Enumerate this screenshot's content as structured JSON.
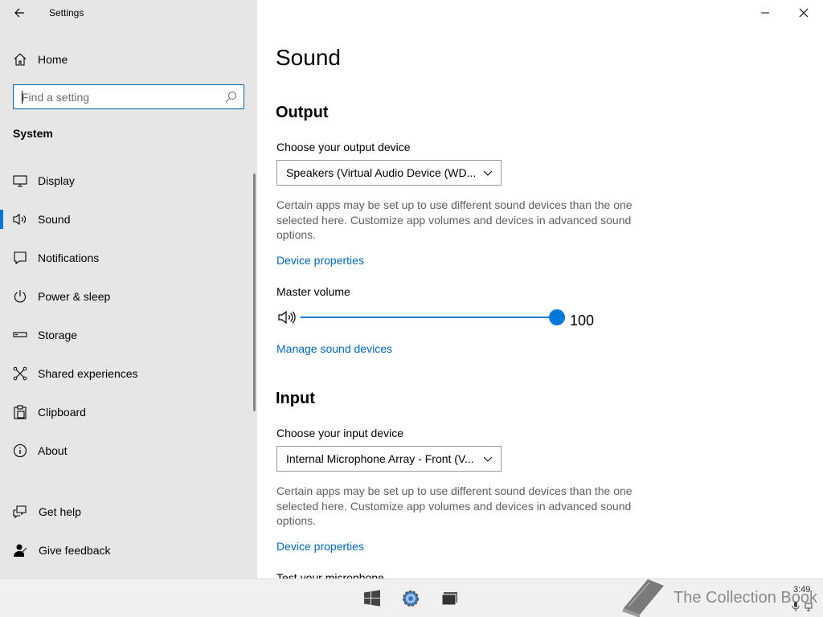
{
  "app": {
    "title": "Settings"
  },
  "sidebar": {
    "home_label": "Home",
    "search_placeholder": "Find a setting",
    "section": "System",
    "items": [
      {
        "label": "Display",
        "icon": "monitor-icon"
      },
      {
        "label": "Sound",
        "icon": "speaker-icon",
        "active": true
      },
      {
        "label": "Notifications",
        "icon": "notification-icon"
      },
      {
        "label": "Power & sleep",
        "icon": "power-icon"
      },
      {
        "label": "Storage",
        "icon": "storage-icon"
      },
      {
        "label": "Shared experiences",
        "icon": "shared-icon"
      },
      {
        "label": "Clipboard",
        "icon": "clipboard-icon"
      },
      {
        "label": "About",
        "icon": "info-icon"
      }
    ],
    "help": {
      "get_help": "Get help",
      "give_feedback": "Give feedback"
    }
  },
  "main": {
    "title": "Sound",
    "output": {
      "heading": "Output",
      "device_label": "Choose your output device",
      "device_value": "Speakers (Virtual Audio Device (WD...",
      "description": "Certain apps may be set up to use different sound devices than the one selected here. Customize app volumes and devices in advanced sound options.",
      "device_properties": "Device properties",
      "master_volume_label": "Master volume",
      "master_volume": 100,
      "master_volume_text": "100",
      "manage_devices": "Manage sound devices"
    },
    "input": {
      "heading": "Input",
      "device_label": "Choose your input device",
      "device_value": "Internal Microphone Array - Front (V...",
      "description": "Certain apps may be set up to use different sound devices than the one selected here. Customize app volumes and devices in advanced sound options.",
      "device_properties": "Device properties",
      "test_label": "Test your microphone"
    }
  },
  "taskbar": {
    "watermark": "The Collection Book",
    "time": "3:49"
  },
  "colors": {
    "accent": "#0078d7",
    "link": "#0067b8",
    "sidebar_bg": "#e6e6e6"
  }
}
